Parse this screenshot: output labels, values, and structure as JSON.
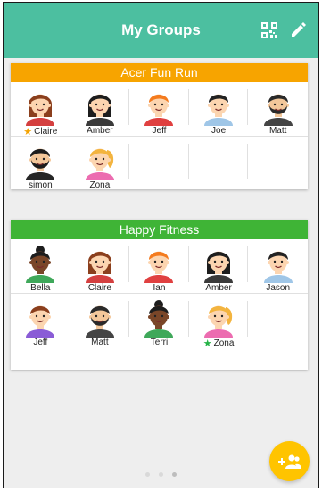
{
  "header": {
    "title": "My Groups"
  },
  "colors": {
    "header": "#4cbfa0",
    "group1": "#f7a400",
    "group2": "#3fb436",
    "fab": "#ffc400"
  },
  "groups": [
    {
      "title": "Acer Fun Run",
      "members": [
        {
          "name": "Claire",
          "avatar": "woman-brown-hair",
          "star": "orange"
        },
        {
          "name": "Amber",
          "avatar": "woman-black-hair"
        },
        {
          "name": "Jeff",
          "avatar": "man-orange-hair"
        },
        {
          "name": "Joe",
          "avatar": "man-black-hair"
        },
        {
          "name": "Matt",
          "avatar": "man-beard"
        },
        {
          "name": "simon",
          "avatar": "man-beard-dark"
        },
        {
          "name": "Zona",
          "avatar": "woman-blonde"
        }
      ]
    },
    {
      "title": "Happy Fitness",
      "members": [
        {
          "name": "Bella",
          "avatar": "woman-dark-skin"
        },
        {
          "name": "Claire",
          "avatar": "woman-brown-hair"
        },
        {
          "name": "Ian",
          "avatar": "man-orange-hair"
        },
        {
          "name": "Amber",
          "avatar": "woman-black-hair"
        },
        {
          "name": "Jason",
          "avatar": "man-black-hair"
        },
        {
          "name": "Jeff",
          "avatar": "man-brown-hair"
        },
        {
          "name": "Matt",
          "avatar": "man-beard"
        },
        {
          "name": "Terri",
          "avatar": "woman-dark-skin"
        },
        {
          "name": "Zona",
          "avatar": "woman-blonde",
          "star": "green"
        }
      ]
    }
  ],
  "pager": {
    "count": 3,
    "active": 2
  },
  "icons": {
    "qr": "qr-code-icon",
    "edit": "pencil-icon",
    "fab": "add-group-icon"
  }
}
